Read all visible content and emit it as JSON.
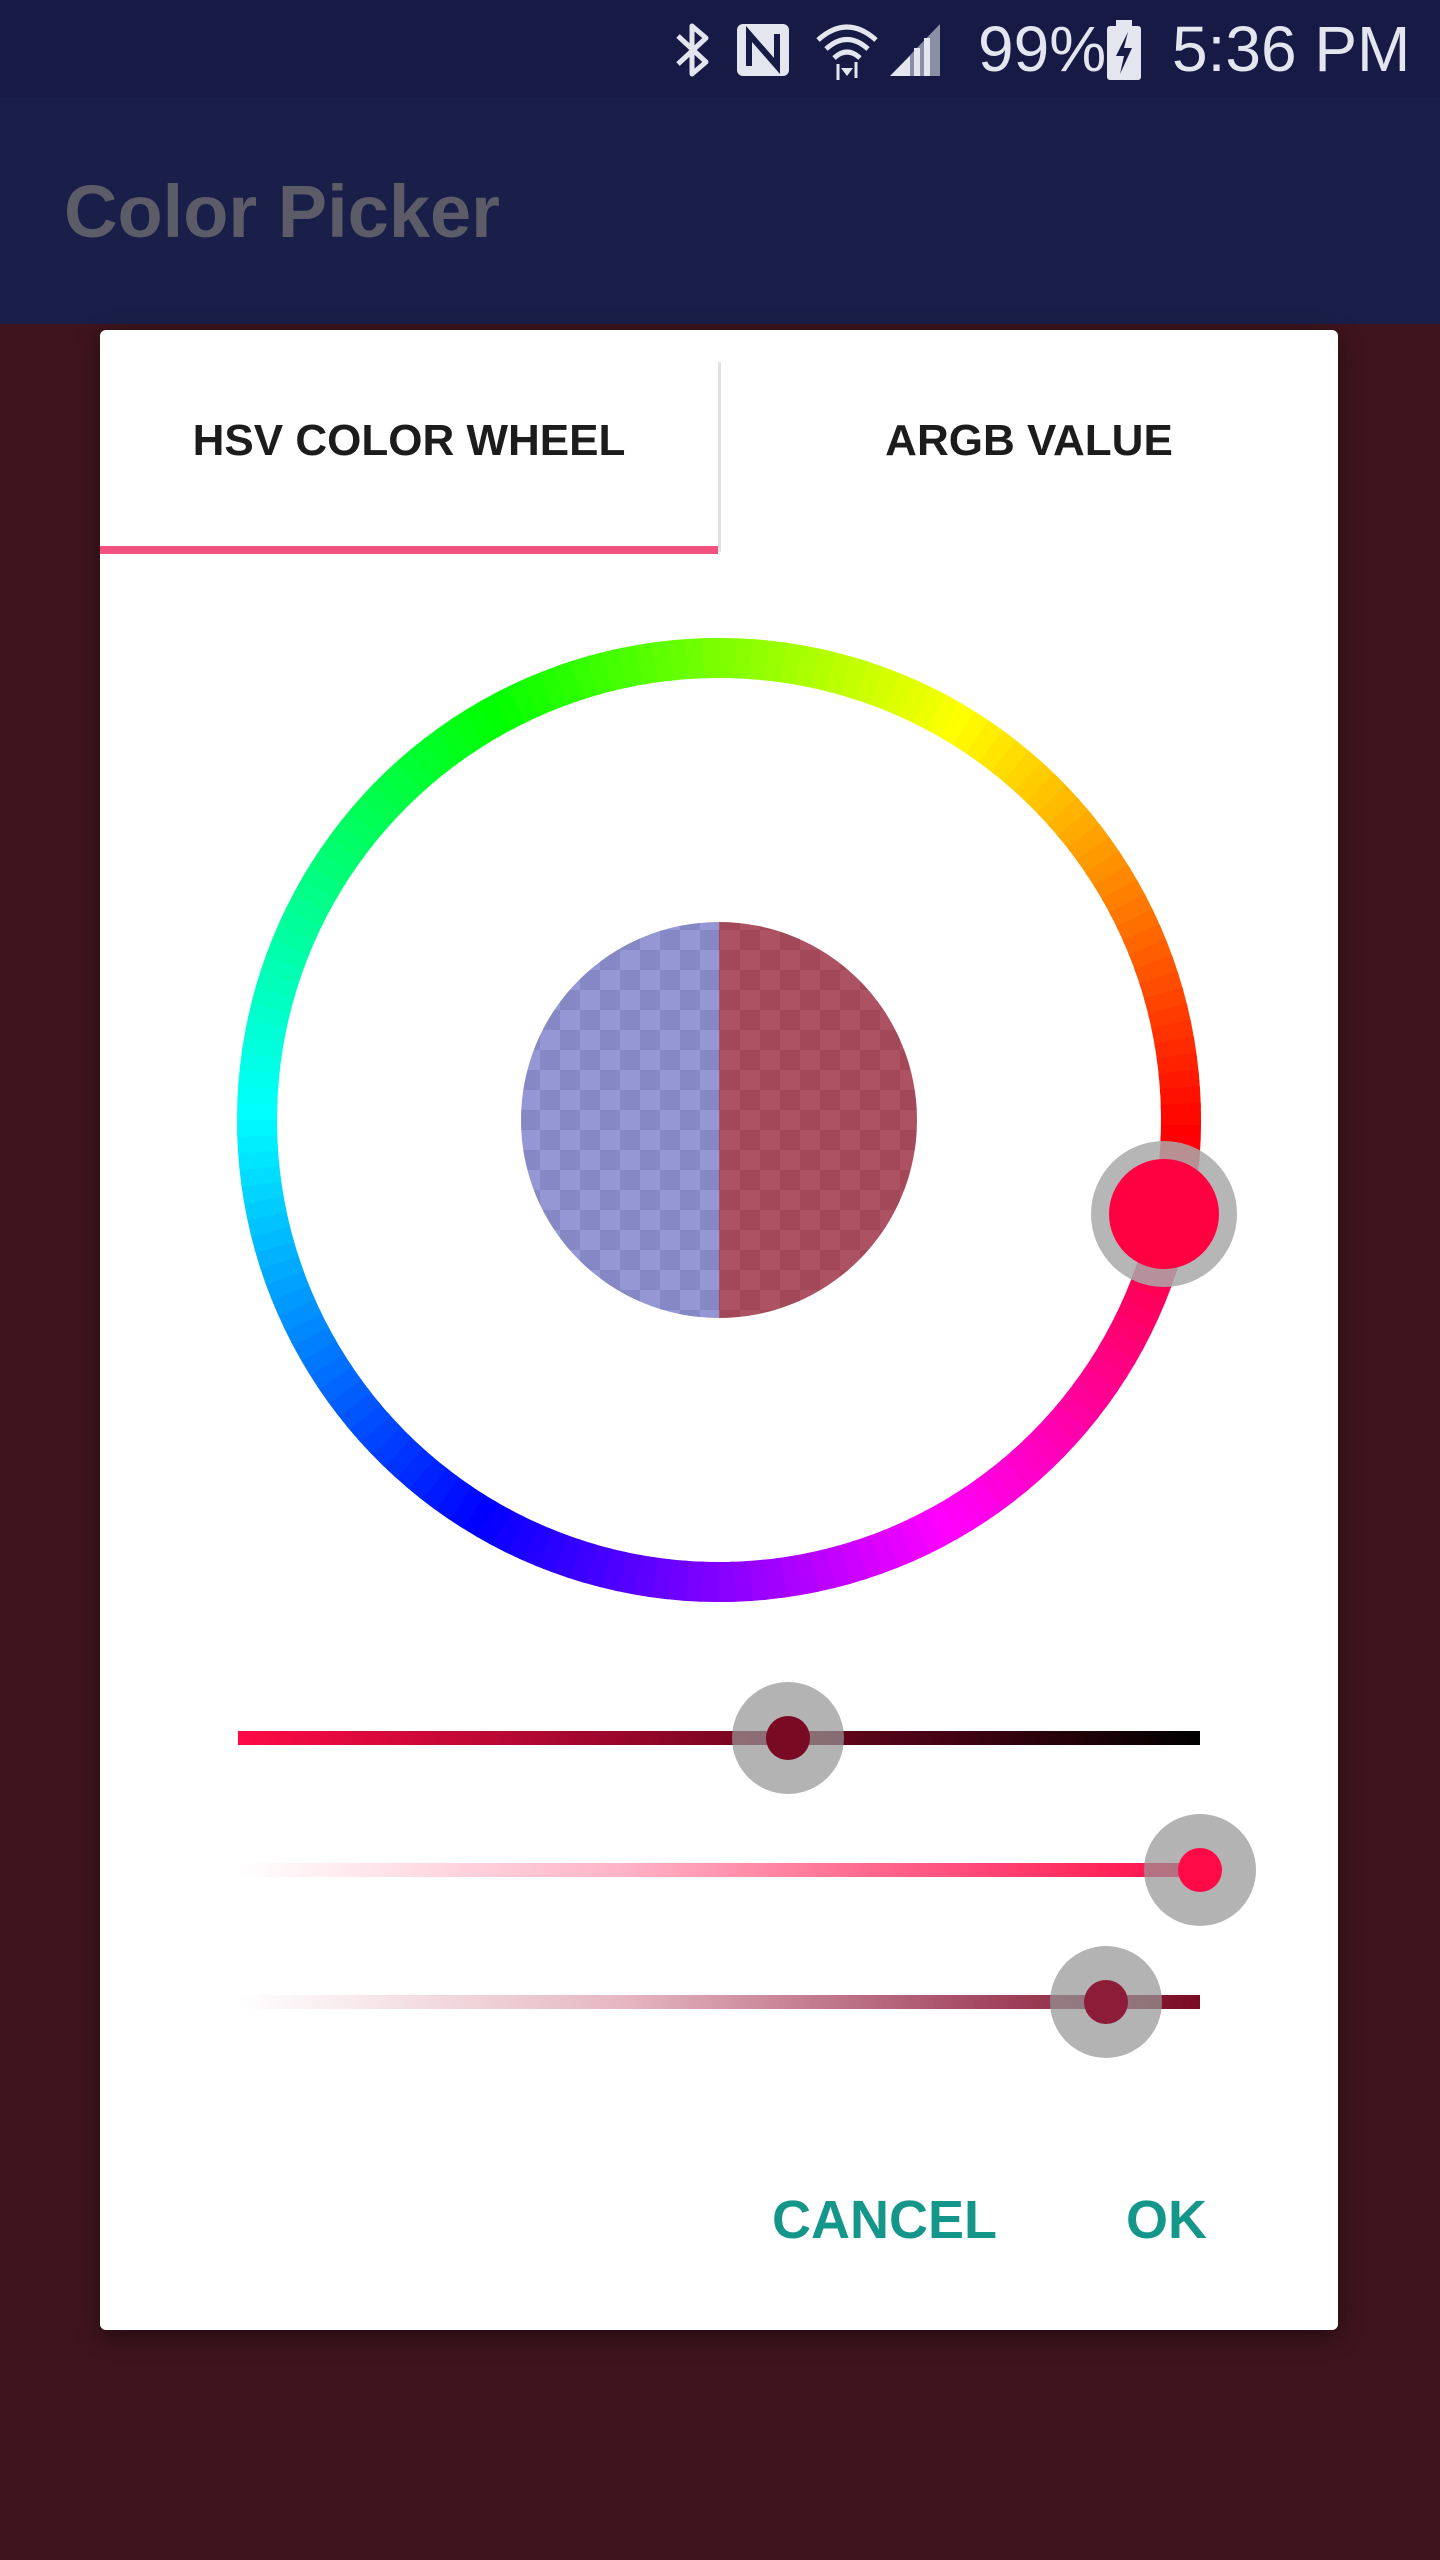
{
  "status_bar": {
    "battery": "99%",
    "time": "5:36 PM",
    "icons": [
      "bluetooth-icon",
      "nfc-icon",
      "wifi-icon",
      "signal-icon",
      "battery-charging-icon"
    ]
  },
  "app_bar": {
    "title": "Color Picker"
  },
  "dialog": {
    "tabs": [
      {
        "label": "HSV COLOR WHEEL",
        "selected": true
      },
      {
        "label": "ARGB VALUE",
        "selected": false
      }
    ],
    "accent_color": "#f0517e",
    "wheel": {
      "selected_color": "#ff0040",
      "preview_old_color": "#6b6fc4",
      "preview_new_color": "#9b2c40"
    },
    "sliders": [
      {
        "name": "value",
        "fraction": 0.47,
        "thumb_color": "#7a0a24"
      },
      {
        "name": "saturation",
        "fraction": 1.0,
        "thumb_color": "#ff0a46"
      },
      {
        "name": "alpha",
        "fraction": 0.8,
        "thumb_color": "#8c1c38"
      }
    ],
    "buttons": {
      "cancel": "CANCEL",
      "ok": "OK"
    },
    "button_color": "#14978a"
  }
}
